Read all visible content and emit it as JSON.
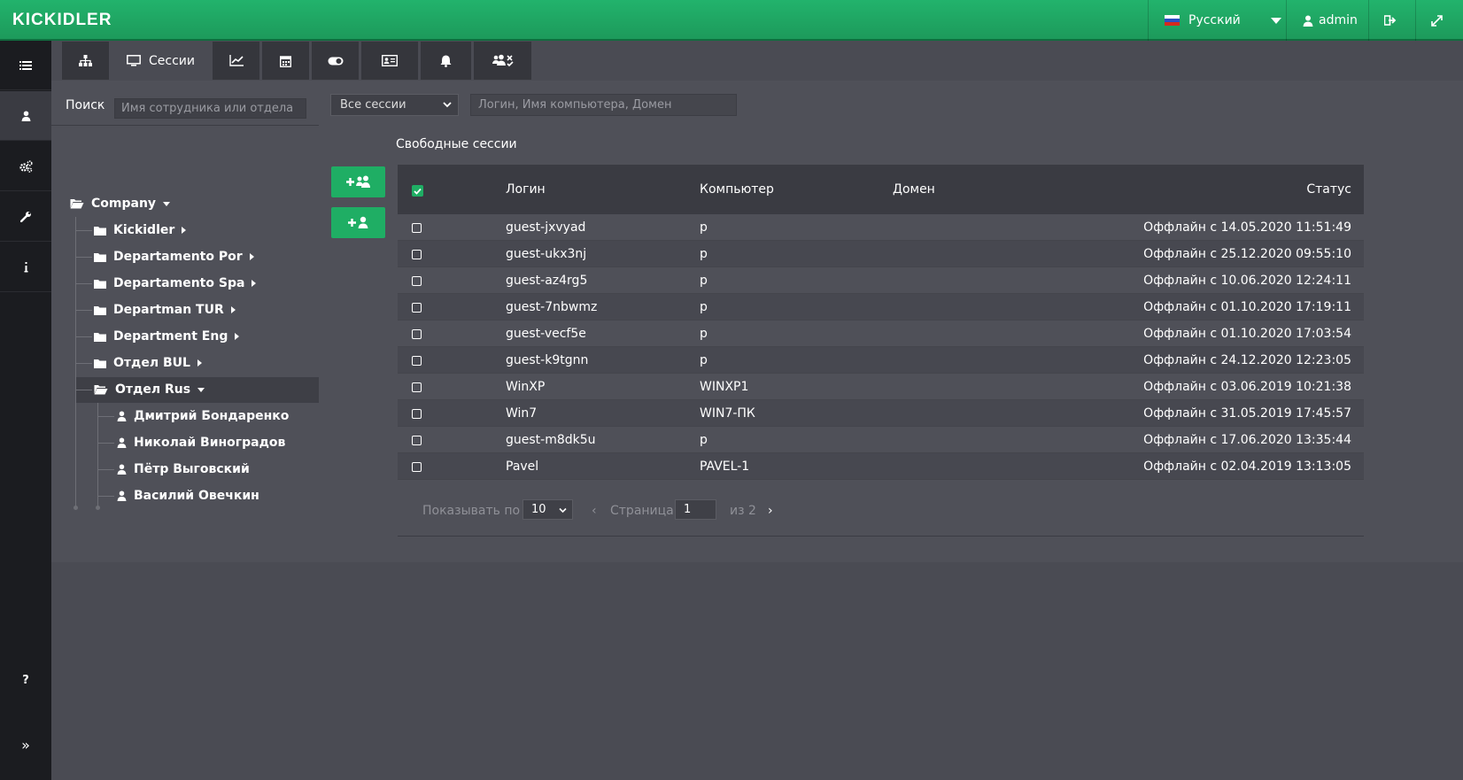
{
  "app": {
    "logo": "KICKIDLER"
  },
  "topbar": {
    "language": "Русский",
    "user": "admin"
  },
  "tabs": [
    {
      "name": "structure",
      "label": "",
      "icon": "sitemap-icon"
    },
    {
      "name": "sessions",
      "label": "Сессии",
      "icon": "monitor-icon",
      "active": true
    },
    {
      "name": "stats",
      "label": "",
      "icon": "chart-line-icon"
    },
    {
      "name": "calendar",
      "label": "",
      "icon": "calendar-icon"
    },
    {
      "name": "toggle",
      "label": "",
      "icon": "toggle-icon"
    },
    {
      "name": "id-card",
      "label": "",
      "icon": "id-card-icon"
    },
    {
      "name": "notifications",
      "label": "",
      "icon": "bell-icon"
    },
    {
      "name": "users-remove",
      "label": "",
      "icon": "users-x-icon"
    }
  ],
  "search": {
    "label": "Поиск",
    "placeholder": "Имя сотрудника или отдела"
  },
  "tree": {
    "root": "Company",
    "departments": [
      "Kickidler",
      "Departamento Por",
      "Departamento Spa",
      "Departman TUR",
      "Department Eng",
      "Отдел BUL",
      "Отдел Rus"
    ],
    "employees": [
      "Дмитрий Бондаренко",
      "Николай Виноградов",
      "Пётр Выговский",
      "Василий Овечкин"
    ]
  },
  "filter": {
    "select_value": "Все сессии",
    "search_placeholder": "Логин, Имя компьютера, Домен"
  },
  "sessions": {
    "title": "Свободные сессии",
    "columns": {
      "login": "Логин",
      "computer": "Компьютер",
      "domain": "Домен",
      "status": "Статус"
    },
    "rows": [
      {
        "login": "guest-jxvyad",
        "computer": "p",
        "domain": "",
        "status": "Оффлайн с 14.05.2020 11:51:49"
      },
      {
        "login": "guest-ukx3nj",
        "computer": "p",
        "domain": "",
        "status": "Оффлайн с 25.12.2020 09:55:10"
      },
      {
        "login": "guest-az4rg5",
        "computer": "p",
        "domain": "",
        "status": "Оффлайн с 10.06.2020 12:24:11"
      },
      {
        "login": "guest-7nbwmz",
        "computer": "p",
        "domain": "",
        "status": "Оффлайн с 01.10.2020 17:19:11"
      },
      {
        "login": "guest-vecf5e",
        "computer": "p",
        "domain": "",
        "status": "Оффлайн с 01.10.2020 17:03:54"
      },
      {
        "login": "guest-k9tgnn",
        "computer": "p",
        "domain": "",
        "status": "Оффлайн с 24.12.2020 12:23:05"
      },
      {
        "login": "WinXP",
        "computer": "WINXP1",
        "domain": "",
        "status": "Оффлайн с 03.06.2019 10:21:38"
      },
      {
        "login": "Win7",
        "computer": "WIN7-ПК",
        "domain": "",
        "status": "Оффлайн с 31.05.2019 17:45:57"
      },
      {
        "login": "guest-m8dk5u",
        "computer": "p",
        "domain": "",
        "status": "Оффлайн с 17.06.2020 13:35:44"
      },
      {
        "login": "Pavel",
        "computer": "PAVEL-1",
        "domain": "",
        "status": "Оффлайн с 02.04.2019 13:13:05"
      }
    ]
  },
  "pagination": {
    "show_label": "Показывать по",
    "page_size": "10",
    "page_label": "Страница",
    "page": "1",
    "of_label": "из 2",
    "prev": "‹",
    "next": "›"
  },
  "sidebar_bottom": {
    "help": "?",
    "expand": "»"
  },
  "colors": {
    "accent": "#1fae64",
    "topbar": "#22b36c",
    "sidebar": "#1b1c20",
    "background": "#4a4b53"
  }
}
